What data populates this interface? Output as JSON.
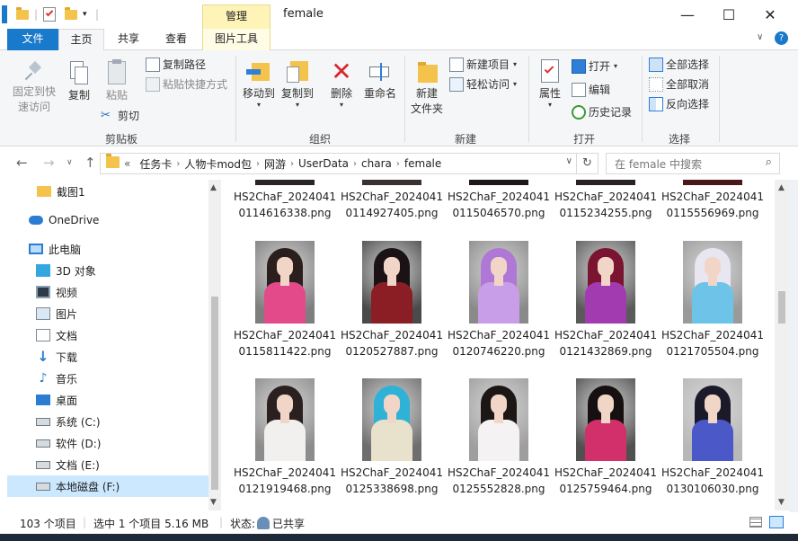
{
  "window": {
    "title": "female",
    "manage_tab": "管理",
    "minimize": "—",
    "maximize": "☐",
    "close": "✕"
  },
  "tabs": [
    {
      "label": "文件"
    },
    {
      "label": "主页"
    },
    {
      "label": "共享"
    },
    {
      "label": "查看"
    },
    {
      "label": "图片工具"
    }
  ],
  "ribbon": {
    "clipboard": {
      "label": "剪贴板",
      "pin": "固定到快速访问",
      "copy": "复制",
      "paste": "粘贴",
      "copy_path": "复制路径",
      "paste_shortcut": "粘贴快捷方式",
      "cut": "剪切"
    },
    "organize": {
      "label": "组织",
      "move_to": "移动到",
      "copy_to": "复制到",
      "delete": "删除",
      "rename": "重命名"
    },
    "new": {
      "label": "新建",
      "new_folder_1": "新建",
      "new_folder_2": "文件夹",
      "new_item": "新建项目",
      "easy_access": "轻松访问"
    },
    "open": {
      "label": "打开",
      "properties": "属性",
      "open": "打开",
      "edit": "编辑",
      "history": "历史记录"
    },
    "select": {
      "label": "选择",
      "select_all": "全部选择",
      "select_none": "全部取消",
      "invert": "反向选择"
    }
  },
  "address": {
    "overflow": "«",
    "crumbs": [
      "任务卡",
      "人物卡mod包",
      "网游",
      "UserData",
      "chara",
      "female"
    ],
    "search_placeholder": "在 female 中搜索"
  },
  "nav": [
    {
      "label": "截图1",
      "icon": "folder-icon"
    },
    {
      "label": "OneDrive",
      "icon": "cloud-icon"
    },
    {
      "label": "此电脑",
      "icon": "computer-icon"
    },
    {
      "label": "3D 对象",
      "icon": "cube-icon"
    },
    {
      "label": "视频",
      "icon": "video-icon"
    },
    {
      "label": "图片",
      "icon": "picture-icon"
    },
    {
      "label": "文档",
      "icon": "document-icon"
    },
    {
      "label": "下载",
      "icon": "download-icon"
    },
    {
      "label": "音乐",
      "icon": "music-icon"
    },
    {
      "label": "桌面",
      "icon": "desktop-icon"
    },
    {
      "label": "系统 (C:)",
      "icon": "drive-icon"
    },
    {
      "label": "软件 (D:)",
      "icon": "drive-icon"
    },
    {
      "label": "文档 (E:)",
      "icon": "drive-icon"
    },
    {
      "label": "本地磁盘 (F:)",
      "icon": "drive-icon"
    }
  ],
  "files": {
    "row0": [
      "HS2ChaF_20240410114616338.png",
      "HS2ChaF_20240410114927405.png",
      "HS2ChaF_20240410115046570.png",
      "HS2ChaF_20240410115234255.png",
      "HS2ChaF_20240410115556969.png"
    ],
    "row1": [
      {
        "name": "HS2ChaF_20240410115811422.png",
        "hair": "#2a1f1c",
        "dress": "#e24a8a",
        "bg": "#7e7e7e"
      },
      {
        "name": "HS2ChaF_20240410120527887.png",
        "hair": "#1a1214",
        "dress": "#8b1d24",
        "bg": "#4a4a4a"
      },
      {
        "name": "HS2ChaF_20240410120746220.png",
        "hair": "#b078d6",
        "dress": "#c99ee8",
        "bg": "#8a8a8a"
      },
      {
        "name": "HS2ChaF_20240410121432869.png",
        "hair": "#7a1430",
        "dress": "#a23bb0",
        "bg": "#5a5a5a"
      },
      {
        "name": "HS2ChaF_20240410121705504.png",
        "hair": "#e8e6f0",
        "dress": "#6ec4e8",
        "bg": "#9a9a9a"
      }
    ],
    "row2": [
      {
        "name": "HS2ChaF_20240410121919468.png",
        "hair": "#2a2020",
        "dress": "#f2f0ee",
        "bg": "#8c8c8c"
      },
      {
        "name": "HS2ChaF_20240410125338698.png",
        "hair": "#2fb2d6",
        "dress": "#e8e2cc",
        "bg": "#6e6e6e"
      },
      {
        "name": "HS2ChaF_20240410125552828.png",
        "hair": "#1c1614",
        "dress": "#f4f2f2",
        "bg": "#9e9e9e"
      },
      {
        "name": "HS2ChaF_20240410125759464.png",
        "hair": "#161010",
        "dress": "#d1306a",
        "bg": "#505050"
      },
      {
        "name": "HS2ChaF_20240410130106030.png",
        "hair": "#1a1a2a",
        "dress": "#4a58c8",
        "bg": "#b8b8b8"
      }
    ]
  },
  "status": {
    "count": "103 个项目",
    "selected": "选中 1 个项目  5.16 MB",
    "state_label": "状态:",
    "state_value": "已共享"
  },
  "colors": {
    "accent": "#1979ca",
    "ribbon_bg": "#f5f6f7",
    "selected_nav": "#cce8ff",
    "manage_tab": "#fff4b8",
    "folder": "#f3c34b"
  }
}
